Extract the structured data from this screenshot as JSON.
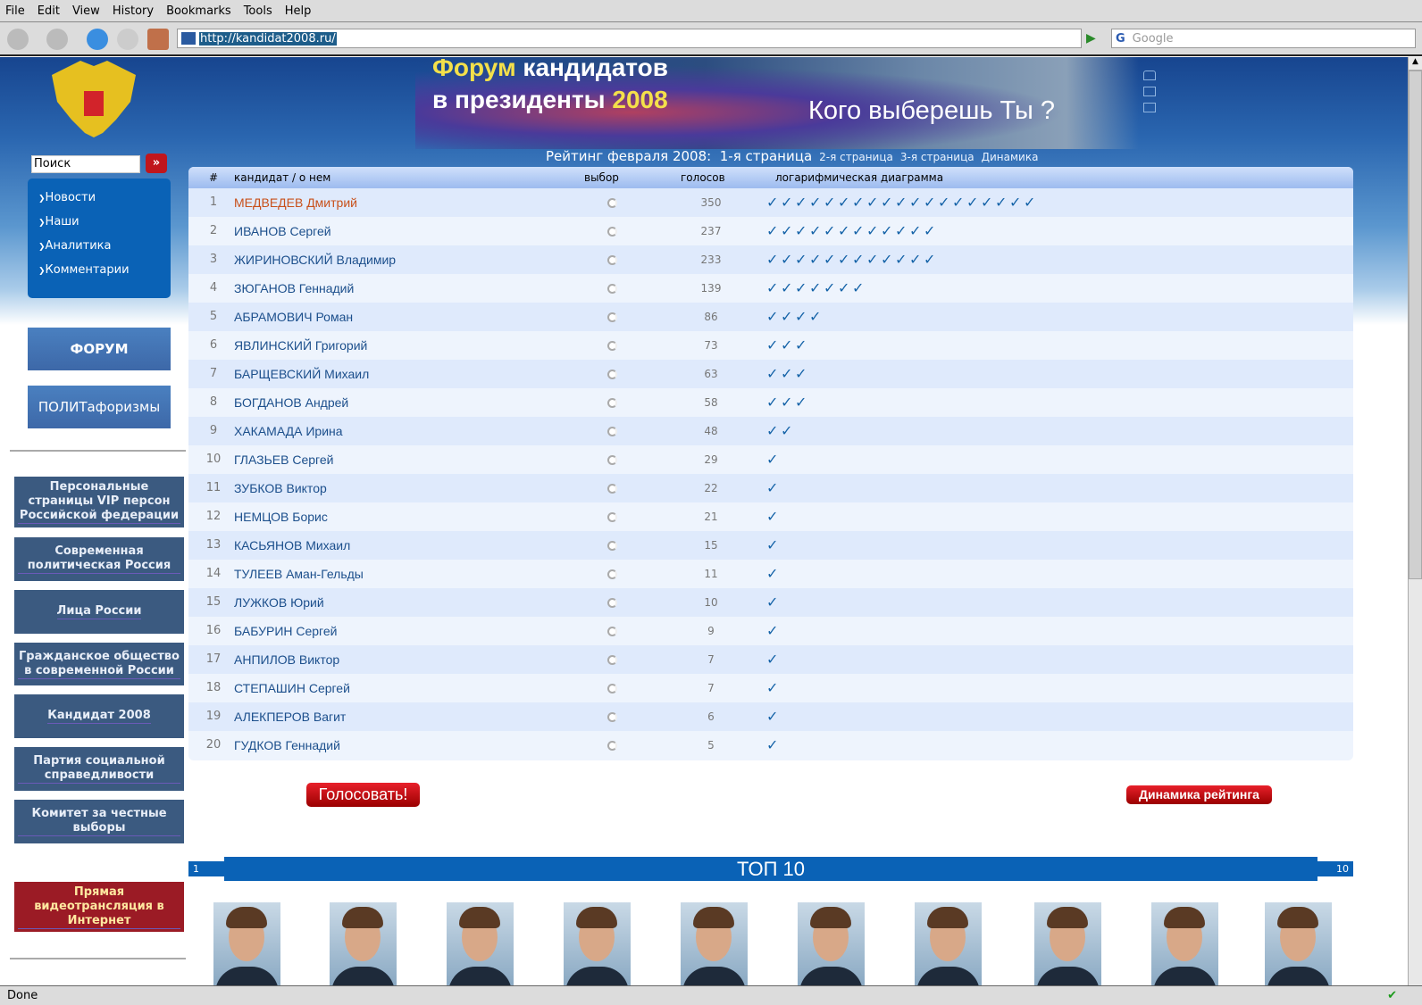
{
  "browser": {
    "menu": [
      "File",
      "Edit",
      "View",
      "History",
      "Bookmarks",
      "Tools",
      "Help"
    ],
    "url": "http://kandidat2008.ru/",
    "search_placeholder": "Google",
    "status": "Done"
  },
  "header": {
    "title_word1": "Форум",
    "title_rest1": " кандидатов",
    "title_line2": "в президенты ",
    "title_year": "2008",
    "slogan": "Кого выберешь Ты ?",
    "icons": [
      "home-icon",
      "mail-icon",
      "rss-icon"
    ]
  },
  "sidebar": {
    "search_value": "Поиск",
    "go_label": "»",
    "nav": [
      "Новости",
      "Наши",
      "Аналитика",
      "Комментарии"
    ],
    "forum_label": "ФОРУМ",
    "aphorisms_label": "ПОЛИТафоризмы",
    "links": [
      "Персональные страницы VIP персон Российской федерации",
      "Современная политическая Россия",
      "Лица России",
      "Гражданское общество в современной России",
      "Кандидат 2008",
      "Партия социальной справедливости",
      "Комитет за честные выборы"
    ],
    "live_label": "Прямая видеотрансляция в Интернет"
  },
  "rating": {
    "label": "Рейтинг февраля 2008:",
    "current_page": "1-я страница",
    "pages": [
      "2-я страница",
      "3-я страница",
      "Динамика"
    ]
  },
  "table": {
    "headers": {
      "num": "#",
      "candidate": "кандидат / о нем",
      "choice": "выбор",
      "votes": "голосов",
      "diagram": "логарифмическая диаграмма"
    },
    "highlight_color": "#c8501a",
    "check_color": "#1563a8",
    "rows": [
      {
        "n": "1",
        "name": "МЕДВЕДЕВ Дмитрий",
        "votes": "350",
        "checks": 19
      },
      {
        "n": "2",
        "name": "ИВАНОВ Сергей",
        "votes": "237",
        "checks": 12
      },
      {
        "n": "3",
        "name": "ЖИРИНОВСКИЙ Владимир",
        "votes": "233",
        "checks": 12
      },
      {
        "n": "4",
        "name": "ЗЮГАНОВ Геннадий",
        "votes": "139",
        "checks": 7
      },
      {
        "n": "5",
        "name": "АБРАМОВИЧ Роман",
        "votes": "86",
        "checks": 4
      },
      {
        "n": "6",
        "name": "ЯВЛИНСКИЙ Григорий",
        "votes": "73",
        "checks": 3
      },
      {
        "n": "7",
        "name": "БАРЩЕВСКИЙ Михаил",
        "votes": "63",
        "checks": 3
      },
      {
        "n": "8",
        "name": "БОГДАНОВ Андрей",
        "votes": "58",
        "checks": 3
      },
      {
        "n": "9",
        "name": "ХАКАМАДА Ирина",
        "votes": "48",
        "checks": 2
      },
      {
        "n": "10",
        "name": "ГЛАЗЬЕВ Сергей",
        "votes": "29",
        "checks": 1
      },
      {
        "n": "11",
        "name": "ЗУБКОВ Виктор",
        "votes": "22",
        "checks": 1
      },
      {
        "n": "12",
        "name": "НЕМЦОВ Борис",
        "votes": "21",
        "checks": 1
      },
      {
        "n": "13",
        "name": "КАСЬЯНОВ Михаил",
        "votes": "15",
        "checks": 1
      },
      {
        "n": "14",
        "name": "ТУЛЕЕВ Аман-Гельды",
        "votes": "11",
        "checks": 1
      },
      {
        "n": "15",
        "name": "ЛУЖКОВ Юрий",
        "votes": "10",
        "checks": 1
      },
      {
        "n": "16",
        "name": "БАБУРИН Сергей",
        "votes": "9",
        "checks": 1
      },
      {
        "n": "17",
        "name": "АНПИЛОВ Виктор",
        "votes": "7",
        "checks": 1
      },
      {
        "n": "18",
        "name": "СТЕПАШИН Сергей",
        "votes": "7",
        "checks": 1
      },
      {
        "n": "19",
        "name": "АЛЕКПЕРОВ Вагит",
        "votes": "6",
        "checks": 1
      },
      {
        "n": "20",
        "name": "ГУДКОВ Геннадий",
        "votes": "5",
        "checks": 1
      }
    ]
  },
  "actions": {
    "vote_label": "Голосовать!",
    "dynamics_label": "Динамика рейтинга"
  },
  "top10": {
    "title": "ТОП 10",
    "left": "1",
    "right": "10",
    "photos": 10
  }
}
